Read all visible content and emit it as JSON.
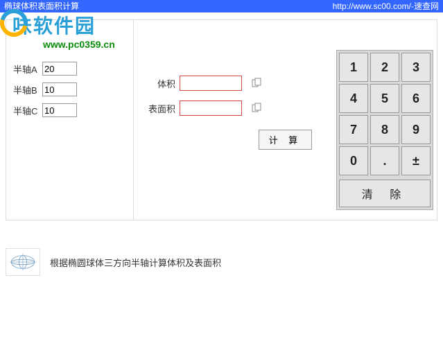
{
  "titlebar": {
    "title": "椭球体积表面积计算",
    "link": "http://www.sc00.com/-速查网"
  },
  "watermark": {
    "name": "味软件园",
    "url": "www.pc0359.cn"
  },
  "inputs": {
    "labelA": "半轴A",
    "valueA": "20",
    "labelB": "半轴B",
    "valueB": "10",
    "labelC": "半轴C",
    "valueC": "10"
  },
  "results": {
    "volumeLabel": "体积",
    "volumeValue": "",
    "surfaceLabel": "表面积",
    "surfaceValue": ""
  },
  "buttons": {
    "calculate": "计 算",
    "clear": "清 除"
  },
  "keypad": {
    "k1": "1",
    "k2": "2",
    "k3": "3",
    "k4": "4",
    "k5": "5",
    "k6": "6",
    "k7": "7",
    "k8": "8",
    "k9": "9",
    "k0": "0",
    "dot": ".",
    "pm": "±"
  },
  "description": "根据椭圆球体三方向半轴计算体积及表面积"
}
